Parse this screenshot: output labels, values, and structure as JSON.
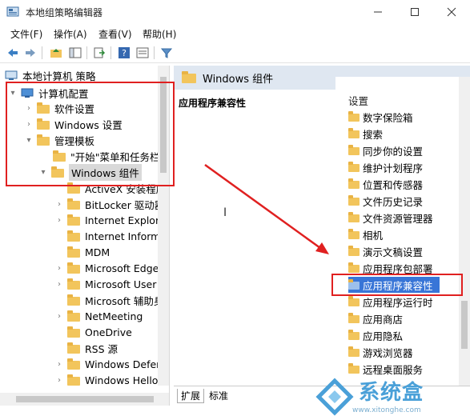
{
  "window": {
    "title": "本地组策略编辑器"
  },
  "menu": {
    "file": "文件(F)",
    "action": "操作(A)",
    "view": "查看(V)",
    "help": "帮助(H)"
  },
  "tree": {
    "root": "本地计算机 策略",
    "items": [
      {
        "label": "计算机配置"
      },
      {
        "label": "软件设置"
      },
      {
        "label": "Windows 设置"
      },
      {
        "label": "管理模板"
      },
      {
        "label": "\"开始\"菜单和任务栏"
      },
      {
        "label": "Windows 组件"
      },
      {
        "label": "ActiveX 安装程序"
      },
      {
        "label": "BitLocker 驱动器"
      },
      {
        "label": "Internet Explorer"
      },
      {
        "label": "Internet Inform"
      },
      {
        "label": "MDM"
      },
      {
        "label": "Microsoft Edge"
      },
      {
        "label": "Microsoft User"
      },
      {
        "label": "Microsoft 辅助身"
      },
      {
        "label": "NetMeeting"
      },
      {
        "label": "OneDrive"
      },
      {
        "label": "RSS 源"
      },
      {
        "label": "Windows Defen"
      },
      {
        "label": "Windows Hello"
      }
    ]
  },
  "right": {
    "header": "Windows 组件",
    "description_title": "应用程序兼容性",
    "list_header": "设置",
    "items": [
      "数字保险箱",
      "搜索",
      "同步你的设置",
      "维护计划程序",
      "位置和传感器",
      "文件历史记录",
      "文件资源管理器",
      "相机",
      "演示文稿设置",
      "应用程序包部署",
      "应用程序兼容性",
      "应用程序运行时",
      "应用商店",
      "应用隐私",
      "游戏浏览器",
      "远程桌面服务"
    ],
    "selected_item": "应用程序兼容性"
  },
  "tabs": {
    "extended": "扩展",
    "standard": "标准"
  },
  "watermark": {
    "name": "系统盒",
    "url": "www.xitonghe.com"
  },
  "colors": {
    "annotation": "#e02020",
    "selection": "#3875d7",
    "folder": "#f2c55c"
  }
}
